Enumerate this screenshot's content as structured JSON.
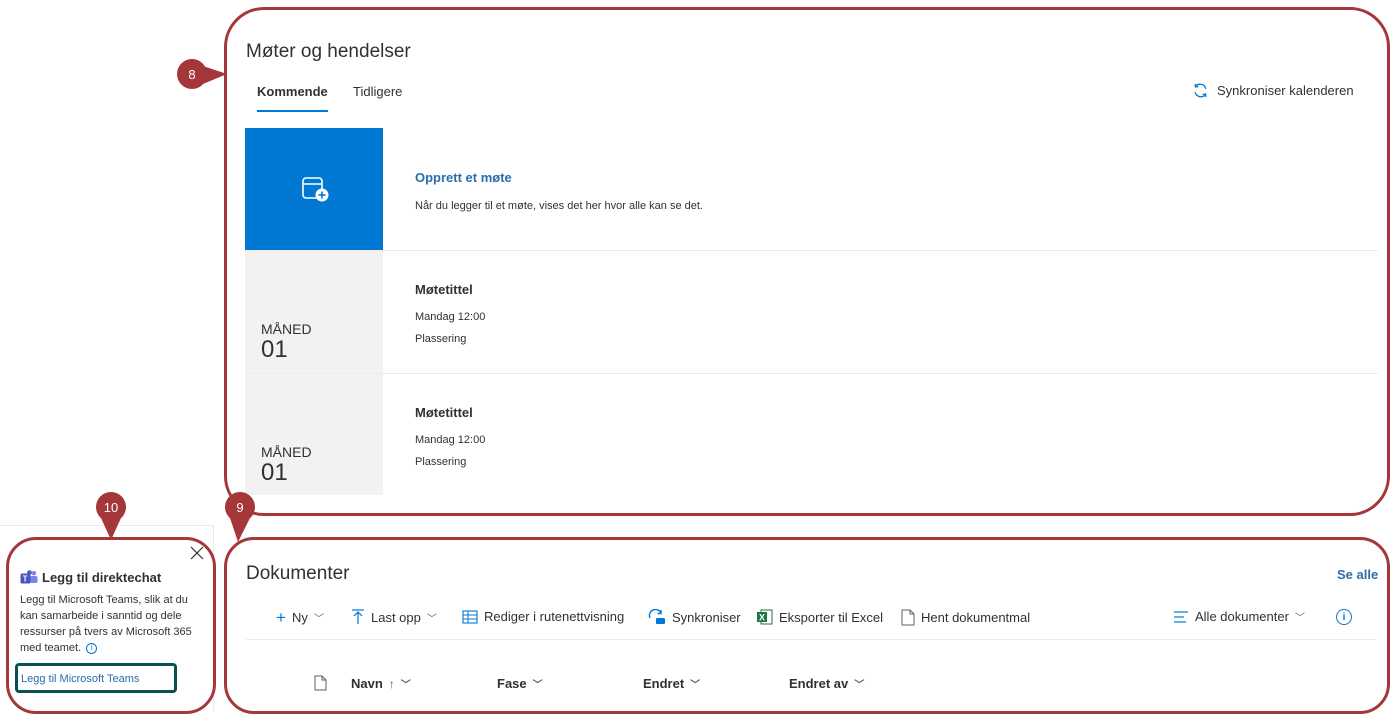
{
  "events": {
    "title": "Møter og hendelser",
    "tabs": [
      {
        "label": "Kommende"
      },
      {
        "label": "Tidligere"
      }
    ],
    "sync_label": "Synkroniser kalenderen",
    "create": {
      "title": "Opprett et møte",
      "description": "Når du legger til et møte, vises det her hvor alle kan se det."
    },
    "meetings": [
      {
        "month": "MÅNED",
        "day": "01",
        "title": "Møtetittel",
        "time": "Mandag 12:00",
        "location": "Plassering"
      },
      {
        "month": "MÅNED",
        "day": "01",
        "title": "Møtetittel",
        "time": "Mandag 12:00",
        "location": "Plassering"
      }
    ]
  },
  "documents": {
    "title": "Dokumenter",
    "see_all": "Se alle",
    "commands": {
      "new": "Ny",
      "upload": "Last opp",
      "grid_edit": "Rediger i rutenettvisning",
      "sync": "Synkroniser",
      "export": "Eksporter til Excel",
      "template": "Hent dokumentmal",
      "view": "Alle dokumenter"
    },
    "columns": {
      "name": "Navn",
      "name_sort": "↑",
      "phase": "Fase",
      "modified": "Endret",
      "modified_by": "Endret av"
    }
  },
  "teams_panel": {
    "title": "Legg til direktechat",
    "body": "Legg til Microsoft Teams, slik at du kan samarbeide i sanntid og dele ressurser på tvers av Microsoft 365 med teamet.",
    "link": "Legg til Microsoft Teams"
  },
  "callouts": {
    "events": "8",
    "documents": "9",
    "teams": "10"
  },
  "colors": {
    "accent": "#0078d4",
    "callout": "#a4373a",
    "link": "#2b6dab",
    "excel": "#217346",
    "focus": "#0b5052"
  }
}
